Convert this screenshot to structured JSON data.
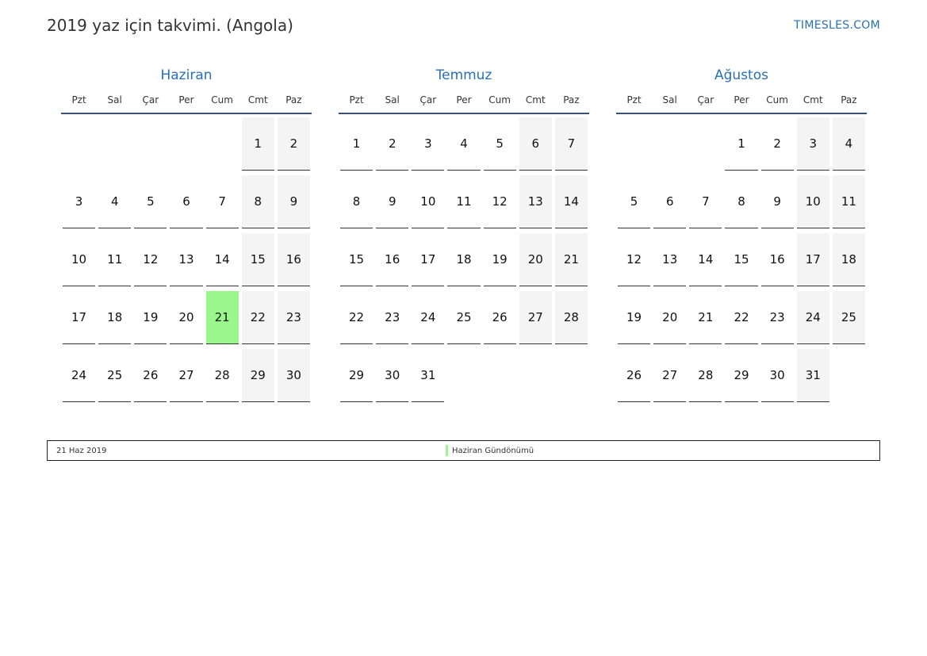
{
  "header": {
    "title": "2019 yaz için takvimi. (Angola)",
    "site": "TIMESLES.COM"
  },
  "weekdays": [
    "Pzt",
    "Sal",
    "Çar",
    "Per",
    "Cum",
    "Cmt",
    "Paz"
  ],
  "months": [
    {
      "name": "Haziran",
      "weeks": [
        [
          "",
          "",
          "",
          "",
          "",
          "1",
          "2"
        ],
        [
          "3",
          "4",
          "5",
          "6",
          "7",
          "8",
          "9"
        ],
        [
          "10",
          "11",
          "12",
          "13",
          "14",
          "15",
          "16"
        ],
        [
          "17",
          "18",
          "19",
          "20",
          "21",
          "22",
          "23"
        ],
        [
          "24",
          "25",
          "26",
          "27",
          "28",
          "29",
          "30"
        ]
      ],
      "holidays": [
        "21"
      ]
    },
    {
      "name": "Temmuz",
      "weeks": [
        [
          "1",
          "2",
          "3",
          "4",
          "5",
          "6",
          "7"
        ],
        [
          "8",
          "9",
          "10",
          "11",
          "12",
          "13",
          "14"
        ],
        [
          "15",
          "16",
          "17",
          "18",
          "19",
          "20",
          "21"
        ],
        [
          "22",
          "23",
          "24",
          "25",
          "26",
          "27",
          "28"
        ],
        [
          "29",
          "30",
          "31",
          "",
          "",
          "",
          ""
        ]
      ],
      "holidays": []
    },
    {
      "name": "Ağustos",
      "weeks": [
        [
          "",
          "",
          "",
          "1",
          "2",
          "3",
          "4"
        ],
        [
          "5",
          "6",
          "7",
          "8",
          "9",
          "10",
          "11"
        ],
        [
          "12",
          "13",
          "14",
          "15",
          "16",
          "17",
          "18"
        ],
        [
          "19",
          "20",
          "21",
          "22",
          "23",
          "24",
          "25"
        ],
        [
          "26",
          "27",
          "28",
          "29",
          "30",
          "31",
          ""
        ]
      ],
      "holidays": []
    }
  ],
  "legend": {
    "date": "21 Haz 2019",
    "label": "Haziran Gündönümü",
    "color": "#9af78c"
  },
  "colors": {
    "accent": "#2a6fb5",
    "weekend": "#f4f4f4",
    "holiday": "#9af78c"
  }
}
